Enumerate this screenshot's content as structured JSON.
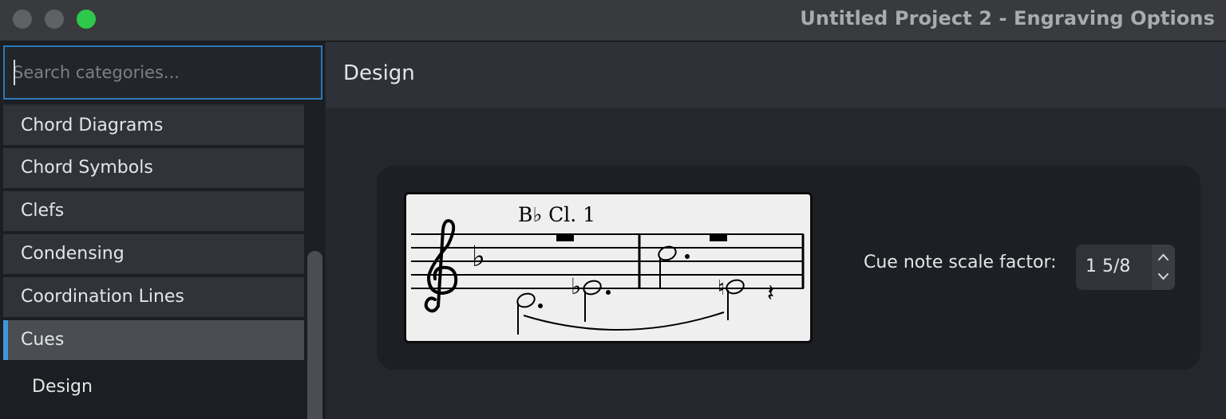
{
  "window": {
    "title": "Untitled Project 2 - Engraving Options"
  },
  "sidebar": {
    "search_placeholder": "Search categories...",
    "items": [
      {
        "label": "Chord Diagrams"
      },
      {
        "label": "Chord Symbols"
      },
      {
        "label": "Clefs"
      },
      {
        "label": "Condensing"
      },
      {
        "label": "Coordination Lines"
      },
      {
        "label": "Cues",
        "selected": true
      }
    ],
    "sub_items": [
      {
        "label": "Design"
      }
    ]
  },
  "main": {
    "section_title": "Design",
    "preview": {
      "instrument_label": "B♭ Cl. 1"
    },
    "option": {
      "label": "Cue note scale factor:",
      "value": "1 5/8"
    }
  },
  "colors": {
    "accent": "#3d9ad8",
    "search_border": "#2c79b8",
    "maximize": "#2ec94a"
  }
}
